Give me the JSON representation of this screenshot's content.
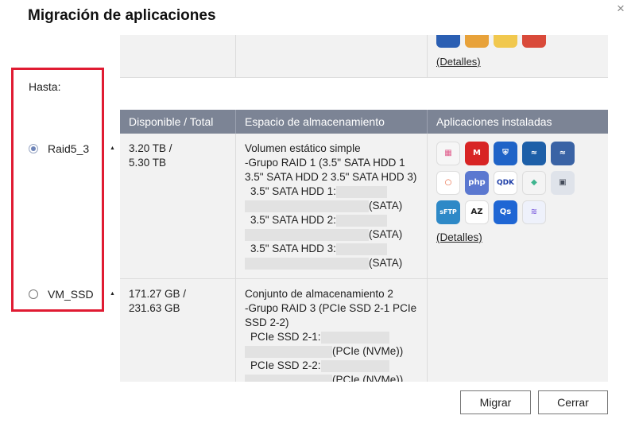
{
  "dialog": {
    "title": "Migración de aplicaciones",
    "close_icon": "×"
  },
  "top_row": {
    "apps": [
      {
        "icon": "qsync-icon",
        "color": "#2b5fb3"
      },
      {
        "icon": "multimedia-icon",
        "color": "#e8a23a"
      },
      {
        "icon": "pma-icon",
        "color": "#f1c84e"
      },
      {
        "icon": "mail-icon",
        "color": "#d94a3a"
      }
    ],
    "details_link": "(Detalles)"
  },
  "target": {
    "label": "Hasta:",
    "options": [
      {
        "name": "Raid5_3",
        "selected": true
      },
      {
        "name": "VM_SSD",
        "selected": false
      }
    ]
  },
  "table": {
    "headers": [
      "Disponible / Total",
      "Espacio de almacenamiento",
      "Aplicaciones instaladas"
    ],
    "rows": [
      {
        "available_line1": "3.20 TB /",
        "available_line2": "5.30 TB",
        "storage_lines": [
          "Volumen estático simple",
          "-Grupo RAID 1 (3.5\" SATA HDD 1",
          "3.5\" SATA HDD 2 3.5\" SATA HDD 3)"
        ],
        "disks": [
          {
            "label": "3.5\" SATA HDD 1:",
            "type": "(SATA)"
          },
          {
            "label": "3.5\" SATA HDD 2:",
            "type": "(SATA)"
          },
          {
            "label": "3.5\" SATA HDD 3:",
            "type": "(SATA)"
          }
        ],
        "apps": [
          {
            "icon": "app-center-icon",
            "text": "▦",
            "color": "#e05a8a"
          },
          {
            "icon": "malware-remover-icon",
            "text": "M",
            "color": "#d82424"
          },
          {
            "icon": "security-counselor-icon",
            "text": "⛨",
            "color": "#1f63c7"
          },
          {
            "icon": "mariadb-icon",
            "text": "≈",
            "color": "#1d5fa8"
          },
          {
            "icon": "mariadb2-icon",
            "text": "≈",
            "color": "#1d5fa8"
          },
          {
            "icon": "hybridmount-icon",
            "text": "○",
            "color": "#e8623a"
          },
          {
            "icon": "php-icon",
            "text": "php",
            "color": "#5b78d0"
          },
          {
            "icon": "qdk-icon",
            "text": "QDK",
            "color": "#ffffff"
          },
          {
            "icon": "container-icon",
            "text": "◆",
            "color": "#3fb58f"
          },
          {
            "icon": "game-icon",
            "text": "▣",
            "color": "#444b5a"
          },
          {
            "icon": "sftp-icon",
            "text": "sFTP",
            "color": "#2e89c7"
          },
          {
            "icon": "sort-az-icon",
            "text": "AZ",
            "color": "#ffffff"
          },
          {
            "icon": "qsirch-icon",
            "text": "Qs",
            "color": "#1f66d4"
          },
          {
            "icon": "wave-icon",
            "text": "≋",
            "color": "#c7d3f2"
          }
        ],
        "details_link": "(Detalles)"
      },
      {
        "available_line1": "171.27 GB /",
        "available_line2": "231.63 GB",
        "storage_lines": [
          "Conjunto de almacenamiento 2",
          "-Grupo RAID 3 (PCIe SSD 2-1 PCIe",
          "SSD 2-2)"
        ],
        "disks": [
          {
            "label": "PCIe SSD 2-1:",
            "type": "(PCIe (NVMe))"
          },
          {
            "label": "PCIe SSD 2-2:",
            "type": "(PCIe (NVMe))"
          }
        ]
      }
    ]
  },
  "buttons": {
    "migrate": "Migrar",
    "close": "Cerrar"
  }
}
